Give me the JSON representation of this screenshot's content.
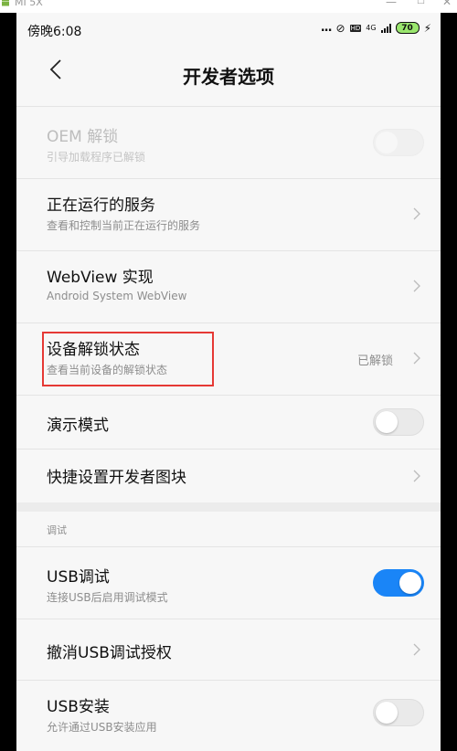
{
  "window": {
    "app_name": "MI 5X",
    "minimize": "—",
    "maximize": "☐",
    "close": "✕"
  },
  "status_bar": {
    "time": "傍晚6:08",
    "dots": "...",
    "network": "4G",
    "hd": "HD",
    "battery": "70"
  },
  "header": {
    "title": "开发者选项"
  },
  "settings": [
    {
      "title": "OEM 解锁",
      "subtitle": "引导加载程序已解锁",
      "control": "toggle",
      "state": "off",
      "disabled": true
    },
    {
      "title": "正在运行的服务",
      "subtitle": "查看和控制当前正在运行的服务",
      "control": "chevron"
    },
    {
      "title": "WebView 实现",
      "subtitle": "Android System WebView",
      "control": "chevron"
    },
    {
      "title": "设备解锁状态",
      "subtitle": "查看当前设备的解锁状态",
      "value": "已解锁",
      "control": "chevron"
    },
    {
      "title": "演示模式",
      "control": "toggle",
      "state": "off"
    },
    {
      "title": "快捷设置开发者图块",
      "control": "chevron"
    }
  ],
  "debug_section": {
    "label": "调试",
    "items": [
      {
        "title": "USB调试",
        "subtitle": "连接USB后启用调试模式",
        "control": "toggle",
        "state": "on"
      },
      {
        "title": "撤消USB调试授权",
        "control": "chevron"
      },
      {
        "title": "USB安装",
        "subtitle": "允许通过USB安装应用",
        "control": "toggle",
        "state": "off"
      }
    ]
  },
  "colors": {
    "accent": "#1a85f7",
    "highlight_box": "#e53935",
    "android_green": "#7cb342"
  }
}
